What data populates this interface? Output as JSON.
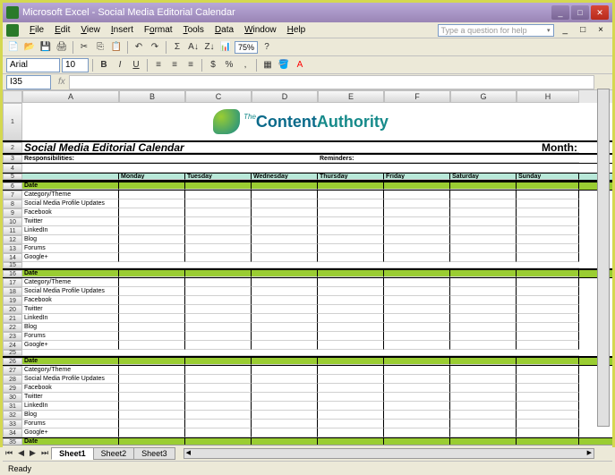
{
  "window": {
    "title": "Microsoft Excel - Social Media Editorial Calendar"
  },
  "menu": {
    "file": "File",
    "edit": "Edit",
    "view": "View",
    "insert": "Insert",
    "format": "Format",
    "tools": "Tools",
    "data": "Data",
    "window": "Window",
    "help": "Help",
    "helpbox": "Type a question for help"
  },
  "toolbar": {
    "zoom": "75%",
    "font": "Arial",
    "size": "10"
  },
  "namebox": "I35",
  "columns": [
    "A",
    "B",
    "C",
    "D",
    "E",
    "F",
    "G",
    "H"
  ],
  "logo": {
    "the": "The",
    "part1": "Content",
    "part2": "Authority"
  },
  "title_row": {
    "title": "Social Media Editorial Calendar",
    "month": "Month:"
  },
  "sub_row": {
    "resp": "Responsibilities:",
    "rem": "Reminders:"
  },
  "days": [
    "Monday",
    "Tuesday",
    "Wednesday",
    "Thursday",
    "Friday",
    "Saturday",
    "Sunday"
  ],
  "block_labels": {
    "date": "Date",
    "category": "Category/Theme",
    "smpu": "Social Media Profile Updates",
    "fb": "Facebook",
    "tw": "Twitter",
    "li": "LinkedIn",
    "blog": "Blog",
    "forums": "Forums",
    "gplus": "Google+"
  },
  "row_numbers": [
    "1",
    "2",
    "3",
    "4",
    "5",
    "6",
    "7",
    "8",
    "9",
    "10",
    "11",
    "12",
    "13",
    "14",
    "15",
    "16",
    "17",
    "18",
    "19",
    "20",
    "21",
    "22",
    "23",
    "24",
    "25",
    "26",
    "27",
    "28",
    "29",
    "30",
    "31",
    "32",
    "33",
    "34",
    "35"
  ],
  "sheets": {
    "s1": "Sheet1",
    "s2": "Sheet2",
    "s3": "Sheet3"
  },
  "status": "Ready"
}
